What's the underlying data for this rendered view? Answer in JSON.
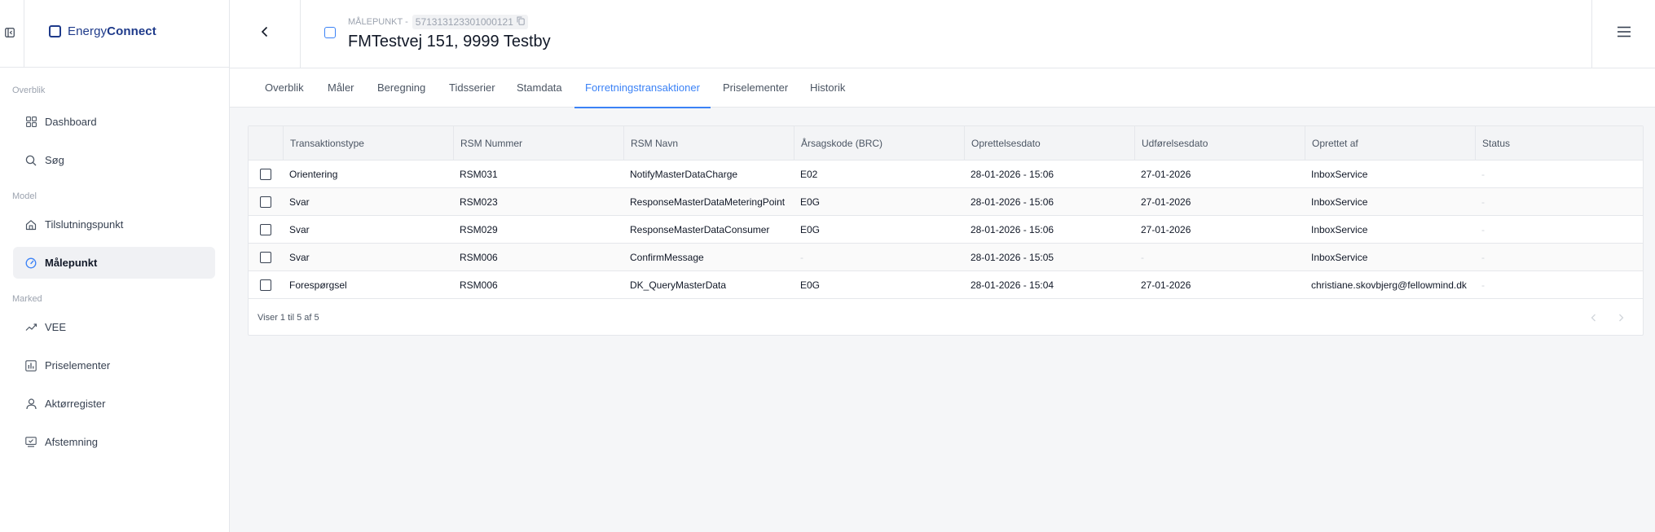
{
  "brand": {
    "name_light": "Energy",
    "name_bold": "Connect"
  },
  "sidebar": {
    "sections": [
      {
        "title": "Overblik",
        "items": [
          {
            "label": "Dashboard",
            "icon": "grid-icon"
          },
          {
            "label": "Søg",
            "icon": "search-icon"
          }
        ]
      },
      {
        "title": "Model",
        "items": [
          {
            "label": "Tilslutningspunkt",
            "icon": "home-icon"
          },
          {
            "label": "Målepunkt",
            "icon": "gauge-icon",
            "active": true
          }
        ]
      },
      {
        "title": "Marked",
        "items": [
          {
            "label": "VEE",
            "icon": "trend-icon"
          },
          {
            "label": "Priselementer",
            "icon": "bar-chart-icon"
          },
          {
            "label": "Aktørregister",
            "icon": "user-icon"
          },
          {
            "label": "Afstemning",
            "icon": "monitor-check-icon"
          }
        ]
      }
    ]
  },
  "header": {
    "type_label": "MÅLEPUNKT -",
    "id": "571313123301000121",
    "title": "FMTestvej 151, 9999 Testby"
  },
  "tabs": [
    "Overblik",
    "Måler",
    "Beregning",
    "Tidsserier",
    "Stamdata",
    "Forretningstransaktioner",
    "Priselementer",
    "Historik"
  ],
  "active_tab": "Forretningstransaktioner",
  "table": {
    "columns": [
      "Transaktionstype",
      "RSM Nummer",
      "RSM Navn",
      "Årsagskode (BRC)",
      "Oprettelsesdato",
      "Udførelsesdato",
      "Oprettet af",
      "Status"
    ],
    "rows": [
      [
        "Orientering",
        "RSM031",
        "NotifyMasterDataCharge",
        "E02",
        "28-01-2026 - 15:06",
        "27-01-2026",
        "InboxService",
        "-"
      ],
      [
        "Svar",
        "RSM023",
        "ResponseMasterDataMeteringPoint",
        "E0G",
        "28-01-2026 - 15:06",
        "27-01-2026",
        "InboxService",
        "-"
      ],
      [
        "Svar",
        "RSM029",
        "ResponseMasterDataConsumer",
        "E0G",
        "28-01-2026 - 15:06",
        "27-01-2026",
        "InboxService",
        "-"
      ],
      [
        "Svar",
        "RSM006",
        "ConfirmMessage",
        "-",
        "28-01-2026 - 15:05",
        "-",
        "InboxService",
        "-"
      ],
      [
        "Forespørgsel",
        "RSM006",
        "DK_QueryMasterData",
        "E0G",
        "28-01-2026 - 15:04",
        "27-01-2026",
        "christiane.skovbjerg@fellowmind.dk",
        "-"
      ]
    ],
    "footer": "Viser 1 til 5 af 5"
  },
  "colors": {
    "accent": "#3b82f6",
    "brand": "#1e3a8a"
  }
}
